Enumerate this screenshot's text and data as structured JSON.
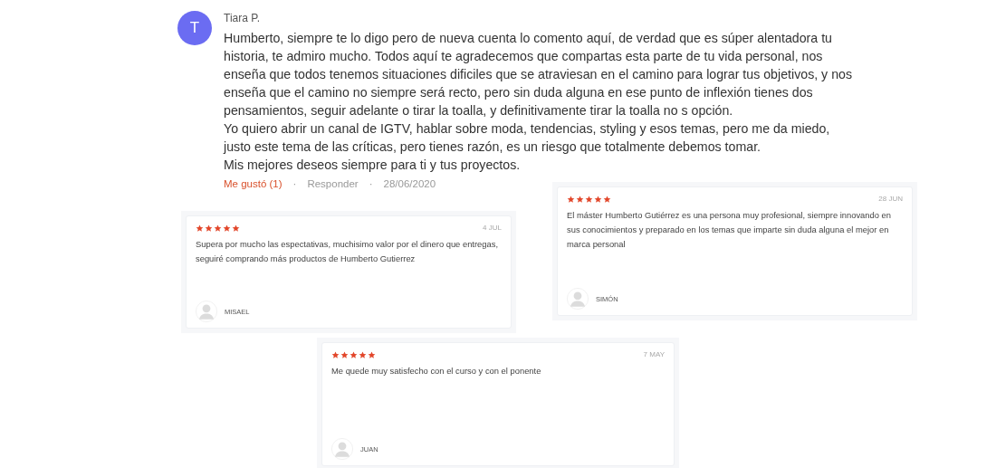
{
  "comment": {
    "avatar_letter": "T",
    "author": "Tiara P.",
    "paragraphs": [
      "Humberto, siempre te lo digo pero de nueva cuenta lo comento aquí, de verdad que es súper alentadora tu historia, te admiro mucho. Todos aquí te agradecemos que compartas esta parte de tu vida personal, nos enseña que todos tenemos situaciones dificiles que se atraviesan en el camino para lograr tus objetivos, y nos enseña que el camino no siempre será recto, pero sin duda alguna en ese punto de inflexión tienes dos pensamientos, seguir adelante o tirar la toalla, y definitivamente tirar la toalla no s opción.",
      "Yo quiero abrir un canal de IGTV, hablar sobre moda, tendencias, styling y esos temas, pero me da miedo, justo este tema de las críticas, pero tienes razón, es un riesgo que totalmente debemos tomar.",
      "Mis mejores deseos siempre para ti y tus proyectos."
    ],
    "like": "Me gustó (1)",
    "separator_1": "·",
    "reply": "Responder",
    "separator_2": "·",
    "date": "28/06/2020"
  },
  "reviews": [
    {
      "stars": 5,
      "date": "4 JUL",
      "text": "Supera por mucho las espectativas, muchisimo valor por el dinero que entregas, seguiré comprando más productos de Humberto Gutierrez",
      "author": "MISAEL"
    },
    {
      "stars": 5,
      "date": "28 JUN",
      "text": "El máster Humberto Gutiérrez es una persona muy profesional, siempre innovando en sus conocimientos y preparado en los temas que imparte sin duda alguna el mejor en marca personal",
      "author": "SIMÓN"
    },
    {
      "stars": 5,
      "date": "7 MAY",
      "text": "Me quede muy satisfecho con el curso y con el ponente",
      "author": "JUAN"
    }
  ]
}
